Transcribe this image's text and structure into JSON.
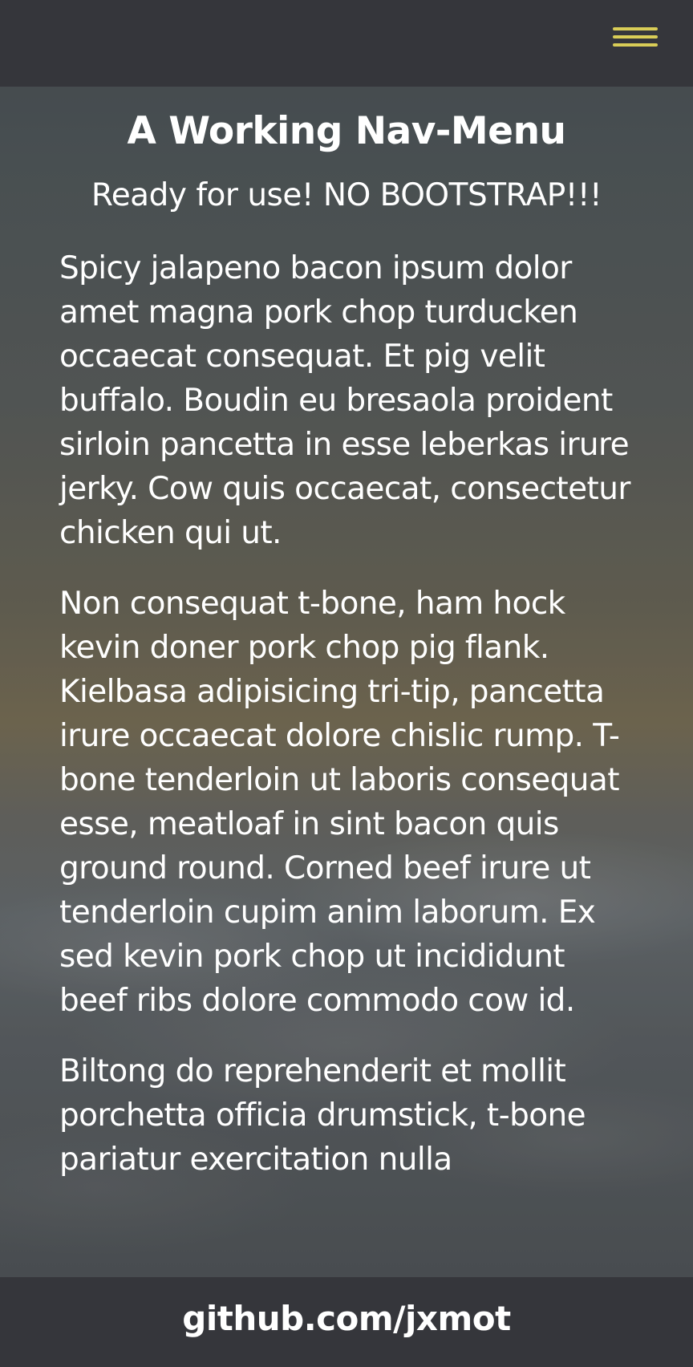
{
  "colors": {
    "bar_background": "#35363b",
    "menu_icon": "#d9cd57",
    "text": "#ffffff"
  },
  "navbar": {
    "menu_icon": "hamburger-menu-icon"
  },
  "main": {
    "title": "A Working Nav-Menu",
    "subtitle": "Ready for use! NO BOOTSTRAP!!!",
    "paragraphs": [
      "Spicy jalapeno bacon ipsum dolor amet magna pork chop turducken occaecat consequat. Et pig velit buffalo. Boudin eu bresaola proident sirloin pancetta in esse leberkas irure jerky. Cow quis occaecat, consectetur chicken qui ut.",
      "Non consequat t-bone, ham hock kevin doner pork chop pig flank. Kielbasa adipisicing tri-tip, pancetta irure occaecat dolore chislic rump. T-bone tenderloin ut laboris consequat esse, meatloaf in sint bacon quis ground round. Corned beef irure ut tenderloin cupim anim laborum. Ex sed kevin pork chop ut incididunt beef ribs dolore commodo cow id.",
      "Biltong do reprehenderit et mollit porchetta officia drumstick, t-bone pariatur exercitation nulla"
    ]
  },
  "footer": {
    "link_text": "github.com/jxmot"
  }
}
